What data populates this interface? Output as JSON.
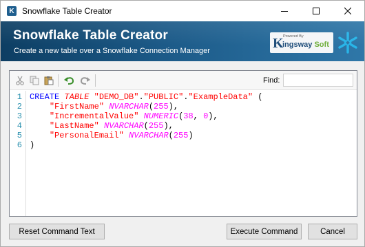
{
  "window": {
    "title": "Snowflake Table Creator",
    "app_icon_letter": "K"
  },
  "banner": {
    "title": "Snowflake Table Creator",
    "subtitle": "Create a new table over a Snowflake Connection Manager",
    "logo_powered": "Powered By",
    "logo_k": "K",
    "logo_ingsway": "ingsway",
    "logo_soft": "Soft"
  },
  "toolbar": {
    "icons": [
      "cut-icon",
      "copy-icon",
      "paste-icon",
      "undo-icon",
      "redo-icon"
    ],
    "find_label": "Find:",
    "find_value": ""
  },
  "editor": {
    "line_numbers": [
      "1",
      "2",
      "3",
      "4",
      "5",
      "6"
    ],
    "lines": [
      [
        {
          "t": "CREATE",
          "c": "kw"
        },
        {
          "t": " ",
          "c": "pun"
        },
        {
          "t": "TABLE",
          "c": "kwi"
        },
        {
          "t": " ",
          "c": "pun"
        },
        {
          "t": "\"DEMO_DB\"",
          "c": "str"
        },
        {
          "t": ".",
          "c": "pun"
        },
        {
          "t": "\"PUBLIC\"",
          "c": "str"
        },
        {
          "t": ".",
          "c": "pun"
        },
        {
          "t": "\"ExampleData\"",
          "c": "str"
        },
        {
          "t": " (",
          "c": "pun"
        }
      ],
      [
        {
          "t": "    ",
          "c": "pun"
        },
        {
          "t": "\"FirstName\"",
          "c": "str"
        },
        {
          "t": " ",
          "c": "pun"
        },
        {
          "t": "NVARCHAR",
          "c": "typ"
        },
        {
          "t": "(",
          "c": "pun"
        },
        {
          "t": "255",
          "c": "num"
        },
        {
          "t": "),",
          "c": "pun"
        }
      ],
      [
        {
          "t": "    ",
          "c": "pun"
        },
        {
          "t": "\"IncrementalValue\"",
          "c": "str"
        },
        {
          "t": " ",
          "c": "pun"
        },
        {
          "t": "NUMERIC",
          "c": "typ"
        },
        {
          "t": "(",
          "c": "pun"
        },
        {
          "t": "38",
          "c": "num"
        },
        {
          "t": ", ",
          "c": "pun"
        },
        {
          "t": "0",
          "c": "num"
        },
        {
          "t": "),",
          "c": "pun"
        }
      ],
      [
        {
          "t": "    ",
          "c": "pun"
        },
        {
          "t": "\"LastName\"",
          "c": "str"
        },
        {
          "t": " ",
          "c": "pun"
        },
        {
          "t": "NVARCHAR",
          "c": "typ"
        },
        {
          "t": "(",
          "c": "pun"
        },
        {
          "t": "255",
          "c": "num"
        },
        {
          "t": "),",
          "c": "pun"
        }
      ],
      [
        {
          "t": "    ",
          "c": "pun"
        },
        {
          "t": "\"PersonalEmail\"",
          "c": "str"
        },
        {
          "t": " ",
          "c": "pun"
        },
        {
          "t": "NVARCHAR",
          "c": "typ"
        },
        {
          "t": "(",
          "c": "pun"
        },
        {
          "t": "255",
          "c": "num"
        },
        {
          "t": ")",
          "c": "pun"
        }
      ],
      [
        {
          "t": ")",
          "c": "pun"
        }
      ]
    ]
  },
  "buttons": {
    "reset": "Reset Command Text",
    "execute": "Execute Command",
    "cancel": "Cancel"
  },
  "colors": {
    "banner_dark": "#0d3e63",
    "banner_light": "#2f77a8",
    "keyword": "#0000ff",
    "string": "#ff0000",
    "type": "#ff00ff",
    "line_number": "#2b91af"
  }
}
